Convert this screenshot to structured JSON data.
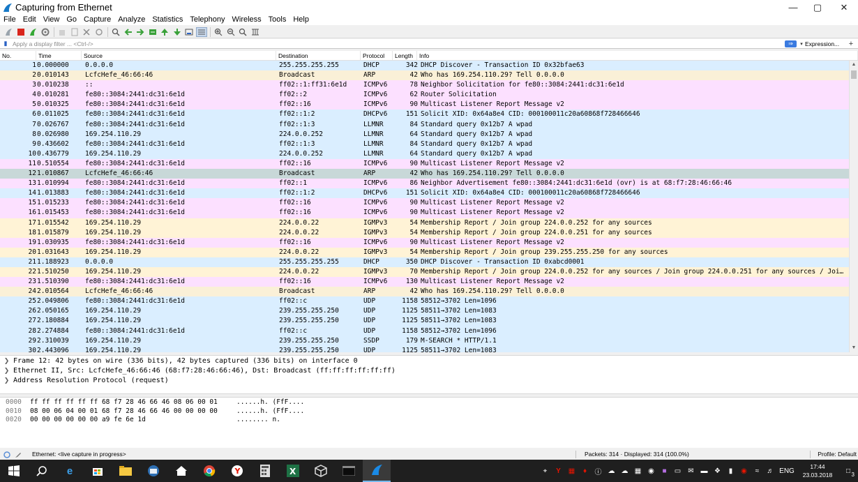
{
  "window": {
    "title": "Capturing from Ethernet",
    "min": "—",
    "max": "▢",
    "close": "✕"
  },
  "menu": [
    "File",
    "Edit",
    "View",
    "Go",
    "Capture",
    "Analyze",
    "Statistics",
    "Telephony",
    "Wireless",
    "Tools",
    "Help"
  ],
  "filter": {
    "placeholder": "Apply a display filter ... <Ctrl-/>",
    "apply": "⇒",
    "dropdown": "▾",
    "expression": "Expression...",
    "plus": "+"
  },
  "columns": {
    "no": "No.",
    "time": "Time",
    "source": "Source",
    "destination": "Destination",
    "protocol": "Protocol",
    "length": "Length",
    "info": "Info"
  },
  "colors": {
    "udp": "#daeeff",
    "arp": "#faf0d7",
    "icmpv6": "#fce0ff",
    "igmp": "#fff3d6",
    "selected": "#c8d8d8"
  },
  "packets": [
    {
      "no": "1",
      "time": "0.000000",
      "src": "0.0.0.0",
      "dst": "255.255.255.255",
      "proto": "DHCP",
      "len": "342",
      "info": "DHCP Discover - Transaction ID 0x32bfae63",
      "cls": "udp"
    },
    {
      "no": "2",
      "time": "0.010143",
      "src": "LcfcHefe_46:66:46",
      "dst": "Broadcast",
      "proto": "ARP",
      "len": "42",
      "info": "Who has 169.254.110.29? Tell 0.0.0.0",
      "cls": "arp"
    },
    {
      "no": "3",
      "time": "0.010238",
      "src": "::",
      "dst": "ff02::1:ff31:6e1d",
      "proto": "ICMPv6",
      "len": "78",
      "info": "Neighbor Solicitation for fe80::3084:2441:dc31:6e1d",
      "cls": "icmpv6"
    },
    {
      "no": "4",
      "time": "0.010281",
      "src": "fe80::3084:2441:dc31:6e1d",
      "dst": "ff02::2",
      "proto": "ICMPv6",
      "len": "62",
      "info": "Router Solicitation",
      "cls": "icmpv6"
    },
    {
      "no": "5",
      "time": "0.010325",
      "src": "fe80::3084:2441:dc31:6e1d",
      "dst": "ff02::16",
      "proto": "ICMPv6",
      "len": "90",
      "info": "Multicast Listener Report Message v2",
      "cls": "icmpv6"
    },
    {
      "no": "6",
      "time": "0.011025",
      "src": "fe80::3084:2441:dc31:6e1d",
      "dst": "ff02::1:2",
      "proto": "DHCPv6",
      "len": "151",
      "info": "Solicit XID: 0x64a8e4 CID: 000100011c20a60868f728466646",
      "cls": "udp"
    },
    {
      "no": "7",
      "time": "0.026767",
      "src": "fe80::3084:2441:dc31:6e1d",
      "dst": "ff02::1:3",
      "proto": "LLMNR",
      "len": "84",
      "info": "Standard query 0x12b7 A wpad",
      "cls": "udp"
    },
    {
      "no": "8",
      "time": "0.026980",
      "src": "169.254.110.29",
      "dst": "224.0.0.252",
      "proto": "LLMNR",
      "len": "64",
      "info": "Standard query 0x12b7 A wpad",
      "cls": "udp"
    },
    {
      "no": "9",
      "time": "0.436602",
      "src": "fe80::3084:2441:dc31:6e1d",
      "dst": "ff02::1:3",
      "proto": "LLMNR",
      "len": "84",
      "info": "Standard query 0x12b7 A wpad",
      "cls": "udp"
    },
    {
      "no": "10",
      "time": "0.436779",
      "src": "169.254.110.29",
      "dst": "224.0.0.252",
      "proto": "LLMNR",
      "len": "64",
      "info": "Standard query 0x12b7 A wpad",
      "cls": "udp"
    },
    {
      "no": "11",
      "time": "0.510554",
      "src": "fe80::3084:2441:dc31:6e1d",
      "dst": "ff02::16",
      "proto": "ICMPv6",
      "len": "90",
      "info": "Multicast Listener Report Message v2",
      "cls": "icmpv6"
    },
    {
      "no": "12",
      "time": "1.010867",
      "src": "LcfcHefe_46:66:46",
      "dst": "Broadcast",
      "proto": "ARP",
      "len": "42",
      "info": "Who has 169.254.110.29? Tell 0.0.0.0",
      "cls": "selected"
    },
    {
      "no": "13",
      "time": "1.010994",
      "src": "fe80::3084:2441:dc31:6e1d",
      "dst": "ff02::1",
      "proto": "ICMPv6",
      "len": "86",
      "info": "Neighbor Advertisement fe80::3084:2441:dc31:6e1d (ovr) is at 68:f7:28:46:66:46",
      "cls": "icmpv6"
    },
    {
      "no": "14",
      "time": "1.013883",
      "src": "fe80::3084:2441:dc31:6e1d",
      "dst": "ff02::1:2",
      "proto": "DHCPv6",
      "len": "151",
      "info": "Solicit XID: 0x64a8e4 CID: 000100011c20a60868f728466646",
      "cls": "udp"
    },
    {
      "no": "15",
      "time": "1.015233",
      "src": "fe80::3084:2441:dc31:6e1d",
      "dst": "ff02::16",
      "proto": "ICMPv6",
      "len": "90",
      "info": "Multicast Listener Report Message v2",
      "cls": "icmpv6"
    },
    {
      "no": "16",
      "time": "1.015453",
      "src": "fe80::3084:2441:dc31:6e1d",
      "dst": "ff02::16",
      "proto": "ICMPv6",
      "len": "90",
      "info": "Multicast Listener Report Message v2",
      "cls": "icmpv6"
    },
    {
      "no": "17",
      "time": "1.015542",
      "src": "169.254.110.29",
      "dst": "224.0.0.22",
      "proto": "IGMPv3",
      "len": "54",
      "info": "Membership Report / Join group 224.0.0.252 for any sources",
      "cls": "igmp"
    },
    {
      "no": "18",
      "time": "1.015879",
      "src": "169.254.110.29",
      "dst": "224.0.0.22",
      "proto": "IGMPv3",
      "len": "54",
      "info": "Membership Report / Join group 224.0.0.251 for any sources",
      "cls": "igmp"
    },
    {
      "no": "19",
      "time": "1.030935",
      "src": "fe80::3084:2441:dc31:6e1d",
      "dst": "ff02::16",
      "proto": "ICMPv6",
      "len": "90",
      "info": "Multicast Listener Report Message v2",
      "cls": "icmpv6"
    },
    {
      "no": "20",
      "time": "1.031643",
      "src": "169.254.110.29",
      "dst": "224.0.0.22",
      "proto": "IGMPv3",
      "len": "54",
      "info": "Membership Report / Join group 239.255.255.250 for any sources",
      "cls": "igmp"
    },
    {
      "no": "21",
      "time": "1.188923",
      "src": "0.0.0.0",
      "dst": "255.255.255.255",
      "proto": "DHCP",
      "len": "350",
      "info": "DHCP Discover - Transaction ID 0xabcd0001",
      "cls": "udp"
    },
    {
      "no": "22",
      "time": "1.510250",
      "src": "169.254.110.29",
      "dst": "224.0.0.22",
      "proto": "IGMPv3",
      "len": "70",
      "info": "Membership Report / Join group 224.0.0.252 for any sources / Join group 224.0.0.251 for any sources / Joi…",
      "cls": "igmp"
    },
    {
      "no": "23",
      "time": "1.510390",
      "src": "fe80::3084:2441:dc31:6e1d",
      "dst": "ff02::16",
      "proto": "ICMPv6",
      "len": "130",
      "info": "Multicast Listener Report Message v2",
      "cls": "icmpv6"
    },
    {
      "no": "24",
      "time": "2.010564",
      "src": "LcfcHefe_46:66:46",
      "dst": "Broadcast",
      "proto": "ARP",
      "len": "42",
      "info": "Who has 169.254.110.29? Tell 0.0.0.0",
      "cls": "arp"
    },
    {
      "no": "25",
      "time": "2.049806",
      "src": "fe80::3084:2441:dc31:6e1d",
      "dst": "ff02::c",
      "proto": "UDP",
      "len": "1158",
      "info": "58512→3702 Len=1096",
      "cls": "udp"
    },
    {
      "no": "26",
      "time": "2.050165",
      "src": "169.254.110.29",
      "dst": "239.255.255.250",
      "proto": "UDP",
      "len": "1125",
      "info": "58511→3702 Len=1083",
      "cls": "udp"
    },
    {
      "no": "27",
      "time": "2.180884",
      "src": "169.254.110.29",
      "dst": "239.255.255.250",
      "proto": "UDP",
      "len": "1125",
      "info": "58511→3702 Len=1083",
      "cls": "udp"
    },
    {
      "no": "28",
      "time": "2.274884",
      "src": "fe80::3084:2441:dc31:6e1d",
      "dst": "ff02::c",
      "proto": "UDP",
      "len": "1158",
      "info": "58512→3702 Len=1096",
      "cls": "udp"
    },
    {
      "no": "29",
      "time": "2.310039",
      "src": "169.254.110.29",
      "dst": "239.255.255.250",
      "proto": "SSDP",
      "len": "179",
      "info": "M-SEARCH * HTTP/1.1",
      "cls": "udp"
    },
    {
      "no": "30",
      "time": "2.443096",
      "src": "169.254.110.29",
      "dst": "239.255.255.250",
      "proto": "UDP",
      "len": "1125",
      "info": "58511→3702 Len=1083",
      "cls": "udp"
    }
  ],
  "details": [
    "Frame 12: 42 bytes on wire (336 bits), 42 bytes captured (336 bits) on interface 0",
    "Ethernet II, Src: LcfcHefe_46:66:46 (68:f7:28:46:66:46), Dst: Broadcast (ff:ff:ff:ff:ff:ff)",
    "Address Resolution Protocol (request)"
  ],
  "bytes": [
    {
      "off": "0000",
      "hex": "ff ff ff ff ff ff 68 f7  28 46 66 46 08 06 00 01",
      "asc": "......h. (FfF...."
    },
    {
      "off": "0010",
      "hex": "08 00 06 04 00 01 68 f7  28 46 66 46 00 00 00 00",
      "asc": "......h. (FfF...."
    },
    {
      "off": "0020",
      "hex": "00 00 00 00 00 00 a9 fe  6e 1d",
      "asc": "........ n."
    }
  ],
  "status": {
    "text": "Ethernet: <live capture in progress>",
    "packets": "Packets: 314 · Displayed: 314 (100.0%)",
    "profile": "Profile: Default"
  },
  "tray": {
    "lang": "ENG",
    "time": "17:44",
    "date": "23.03.2018",
    "notif": "3"
  }
}
